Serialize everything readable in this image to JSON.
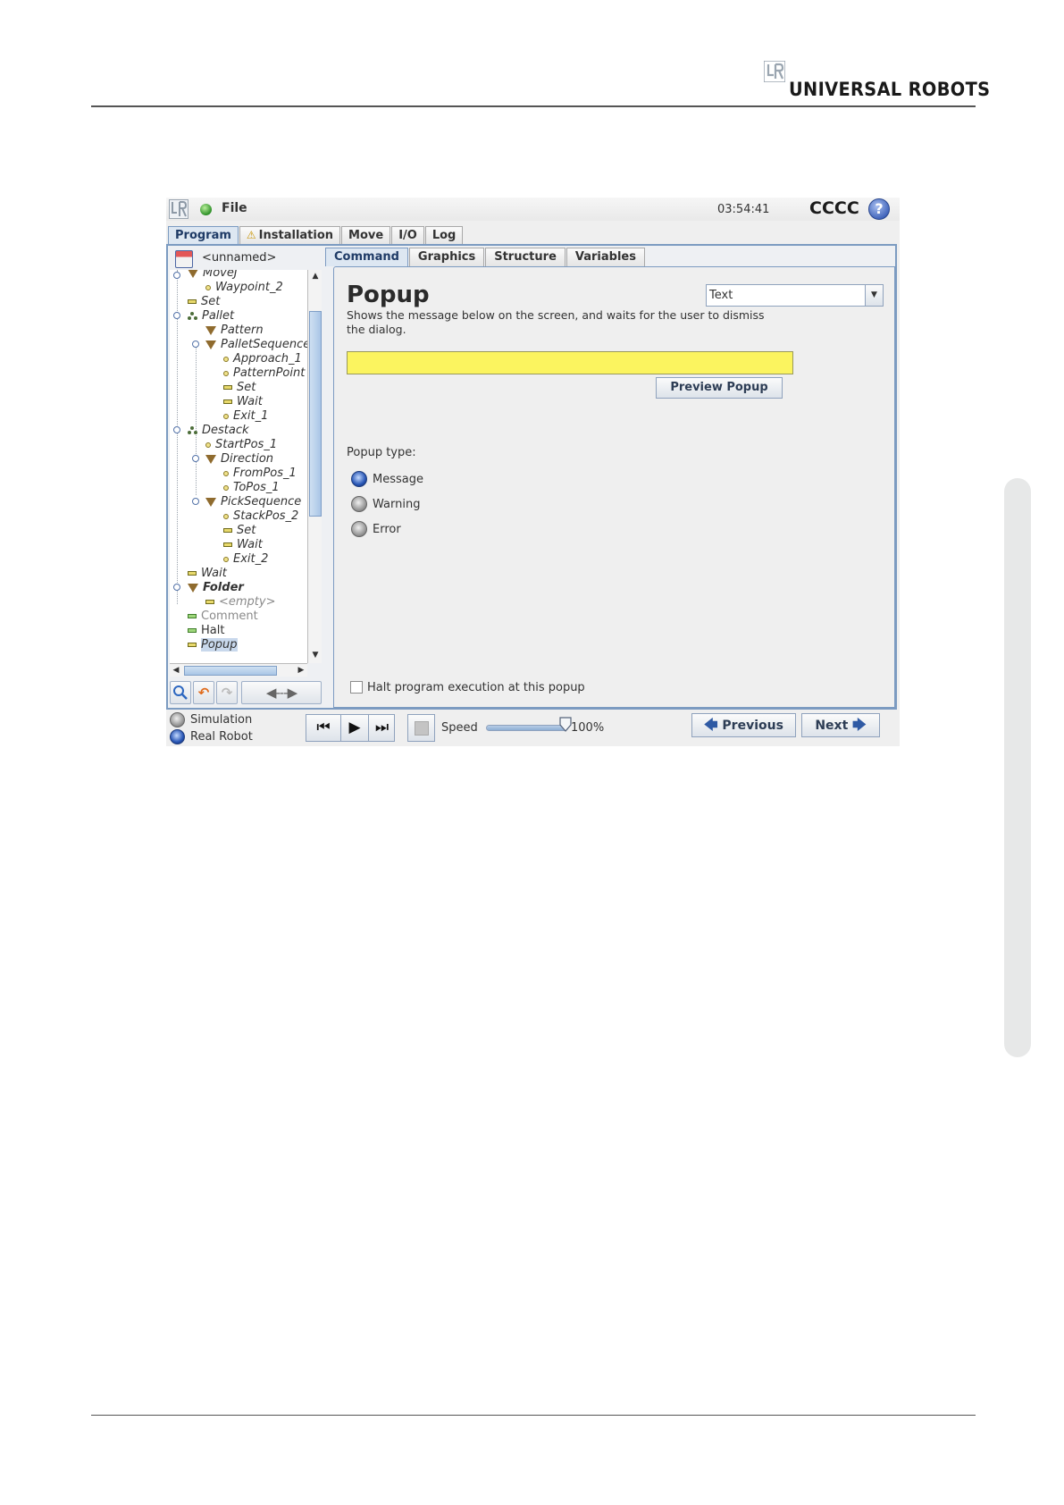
{
  "page": {
    "brand_text": "UNIVERSAL ROBOTS"
  },
  "titlebar": {
    "file_menu": "File",
    "clock": "03:54:41",
    "robot_name": "CCCC",
    "help_glyph": "?",
    "status_color": "#2c8f26"
  },
  "main_tabs": [
    {
      "label": "Program",
      "active": true
    },
    {
      "label": "Installation",
      "warning": true
    },
    {
      "label": "Move"
    },
    {
      "label": "I/O"
    },
    {
      "label": "Log"
    }
  ],
  "program": {
    "name": "<unnamed>"
  },
  "tree": [
    {
      "label": "MoveJ",
      "icon": "triangle"
    },
    {
      "label": "Waypoint_2",
      "icon": "dot"
    },
    {
      "label": "Set",
      "icon": "bar"
    },
    {
      "label": "Pallet",
      "icon": "pallet"
    },
    {
      "label": "Pattern",
      "icon": "triangle"
    },
    {
      "label": "PalletSequence",
      "icon": "triangle"
    },
    {
      "label": "Approach_1",
      "icon": "dot"
    },
    {
      "label": "PatternPoint",
      "icon": "dot"
    },
    {
      "label": "Set",
      "icon": "bar"
    },
    {
      "label": "Wait",
      "icon": "bar"
    },
    {
      "label": "Exit_1",
      "icon": "dot"
    },
    {
      "label": "Destack",
      "icon": "pallet"
    },
    {
      "label": "StartPos_1",
      "icon": "dot"
    },
    {
      "label": "Direction",
      "icon": "triangle"
    },
    {
      "label": "FromPos_1",
      "icon": "dot"
    },
    {
      "label": "ToPos_1",
      "icon": "dot"
    },
    {
      "label": "PickSequence",
      "icon": "triangle"
    },
    {
      "label": "StackPos_2",
      "icon": "dot"
    },
    {
      "label": "Set",
      "icon": "bar"
    },
    {
      "label": "Wait",
      "icon": "bar"
    },
    {
      "label": "Exit_2",
      "icon": "dot"
    },
    {
      "label": "Wait",
      "icon": "bar"
    },
    {
      "label": "Folder",
      "icon": "triangle",
      "style": "bold"
    },
    {
      "label": "<empty>",
      "icon": "bar",
      "style": "grey"
    },
    {
      "label": "Comment",
      "icon": "bar-green",
      "style": "grey"
    },
    {
      "label": "Halt",
      "icon": "bar-green",
      "style": "plain"
    },
    {
      "label": "Popup",
      "icon": "bar",
      "selected": true
    }
  ],
  "tree_tools": {
    "search_icon": "search-icon",
    "undo_glyph": "↶",
    "redo_glyph": "↷",
    "move_glyph": "◀---▶"
  },
  "sub_tabs": [
    {
      "label": "Command",
      "active": true
    },
    {
      "label": "Graphics"
    },
    {
      "label": "Structure"
    },
    {
      "label": "Variables"
    }
  ],
  "command": {
    "title": "Popup",
    "description": "Shows the message below on the screen, and waits for the user to dismiss the dialog.",
    "type_select_value": "Text",
    "message_value": "",
    "message_bg": "#fbf45f",
    "preview_label": "Preview Popup",
    "popup_type_label": "Popup type:",
    "popup_types": [
      {
        "label": "Message",
        "selected": true
      },
      {
        "label": "Warning",
        "selected": false
      },
      {
        "label": "Error",
        "selected": false
      }
    ],
    "halt_label": "Halt program execution at this popup",
    "halt_checked": false
  },
  "footer": {
    "modes": [
      {
        "label": "Simulation",
        "selected": false
      },
      {
        "label": "Real Robot",
        "selected": true
      }
    ],
    "speed_label": "Speed",
    "speed_value": "100%",
    "speed_fraction": 1.0,
    "previous_label": "Previous",
    "next_label": "Next"
  }
}
